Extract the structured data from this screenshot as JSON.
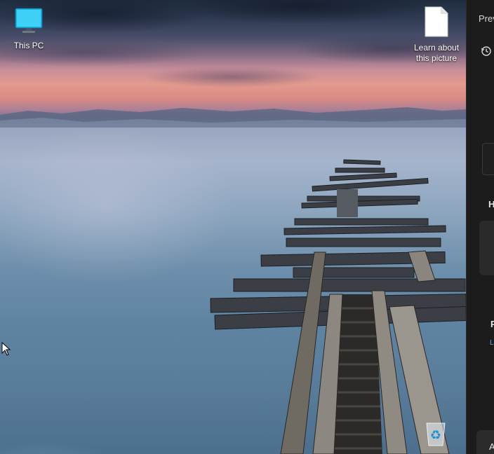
{
  "desktop": {
    "icons": [
      {
        "label": "This PC",
        "icon": "monitor-icon"
      },
      {
        "label": "Learn about this picture",
        "label_line1": "Learn about",
        "label_line2": "this picture",
        "icon": "document-icon"
      },
      {
        "label": "",
        "icon": "recycle-bin-icon"
      }
    ],
    "wallpaper": "pier-over-lake-at-dusk"
  },
  "side_panel": {
    "title": "Prev",
    "history_icon": "history-icon",
    "section_h": "H",
    "section_p": "P",
    "link_text": "Le",
    "bottom_button": "A"
  },
  "colors": {
    "panel_bg": "#1c1c1c",
    "link": "#5ea8e6",
    "icon_text": "#ffffff"
  }
}
